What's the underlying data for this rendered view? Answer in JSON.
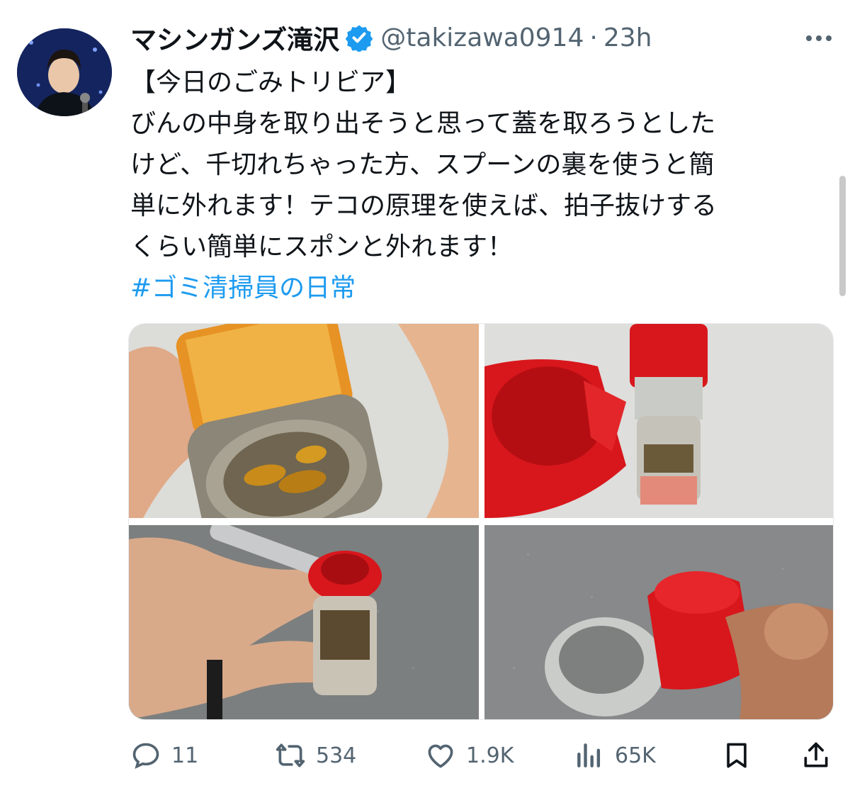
{
  "tweet": {
    "display_name": "マシンガンズ滝沢",
    "handle": "@takizawa0914",
    "separator": "·",
    "time": "23h",
    "text_lines": [
      "【今日のごみトリビア】",
      "びんの中身を取り出そうと思って蓋を取ろうとした",
      "けど、千切れちゃった方、スプーンの裏を使うと簡",
      "単に外れます！テコの原理を使えば、拍子抜けする",
      "くらい簡単にスポンと外れます！"
    ],
    "hashtag": "#ゴミ清掃員の日常"
  },
  "actions": {
    "replies": "11",
    "retweets": "534",
    "likes": "1.9K",
    "views": "65K"
  },
  "icons": {
    "verified": "verified-badge-icon",
    "more": "more-dots-icon",
    "reply": "reply-icon",
    "retweet": "retweet-icon",
    "like": "heart-icon",
    "views": "views-chart-icon",
    "bookmark": "bookmark-icon",
    "share": "share-icon"
  },
  "colors": {
    "accent": "#1d9bf0",
    "text": "#0f1419",
    "secondary": "#536471",
    "cap_red": "#d8171c"
  }
}
